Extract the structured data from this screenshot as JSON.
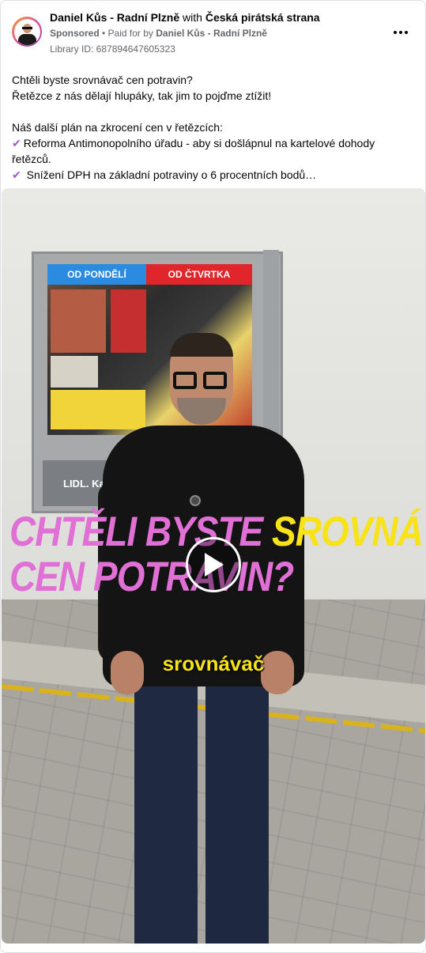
{
  "post": {
    "page_name": "Daniel Kůs - Radní Plzně",
    "with_word": "with",
    "partner": "Česká pirátská strana",
    "sponsored": "Sponsored",
    "paid_for_by_prefix": "• Paid for by",
    "payer": "Daniel Kůs - Radní Plzně",
    "library_id": "Library ID: 687894647605323",
    "body": {
      "line1": "Chtěli byste srovnávač cen potravin?",
      "line2": "Řetězce z nás dělají hlupáky, tak jim to pojďme ztížit!",
      "line3": "Náš další plán na zkrocení cen v řetězcích:",
      "bullet1": "Reforma Antimonopolního úřadu - aby si došlápnul na kartelové dohody řetězců.",
      "bullet2": "Snížení DPH na základní potraviny o 6 procentních bodů…",
      "check_glyph": "✔"
    }
  },
  "video": {
    "overlay_part1": "CHTĚLI BYSTE ",
    "overlay_part2": "SROVNÁVAČ",
    "overlay_line2": "CEN POTRAVIN?",
    "caption": "srovnávač",
    "sign_left": "OD PONDĚLÍ",
    "sign_right": "OD ČTVRTKA",
    "store_plate": "LIDL. Každ"
  },
  "icons": {
    "more": "more-options-icon",
    "play": "play-icon",
    "check": "check-icon"
  },
  "colors": {
    "overlay_pink": "#e070d6",
    "overlay_yellow": "#f7e318",
    "check_purple": "#9b59d0"
  }
}
